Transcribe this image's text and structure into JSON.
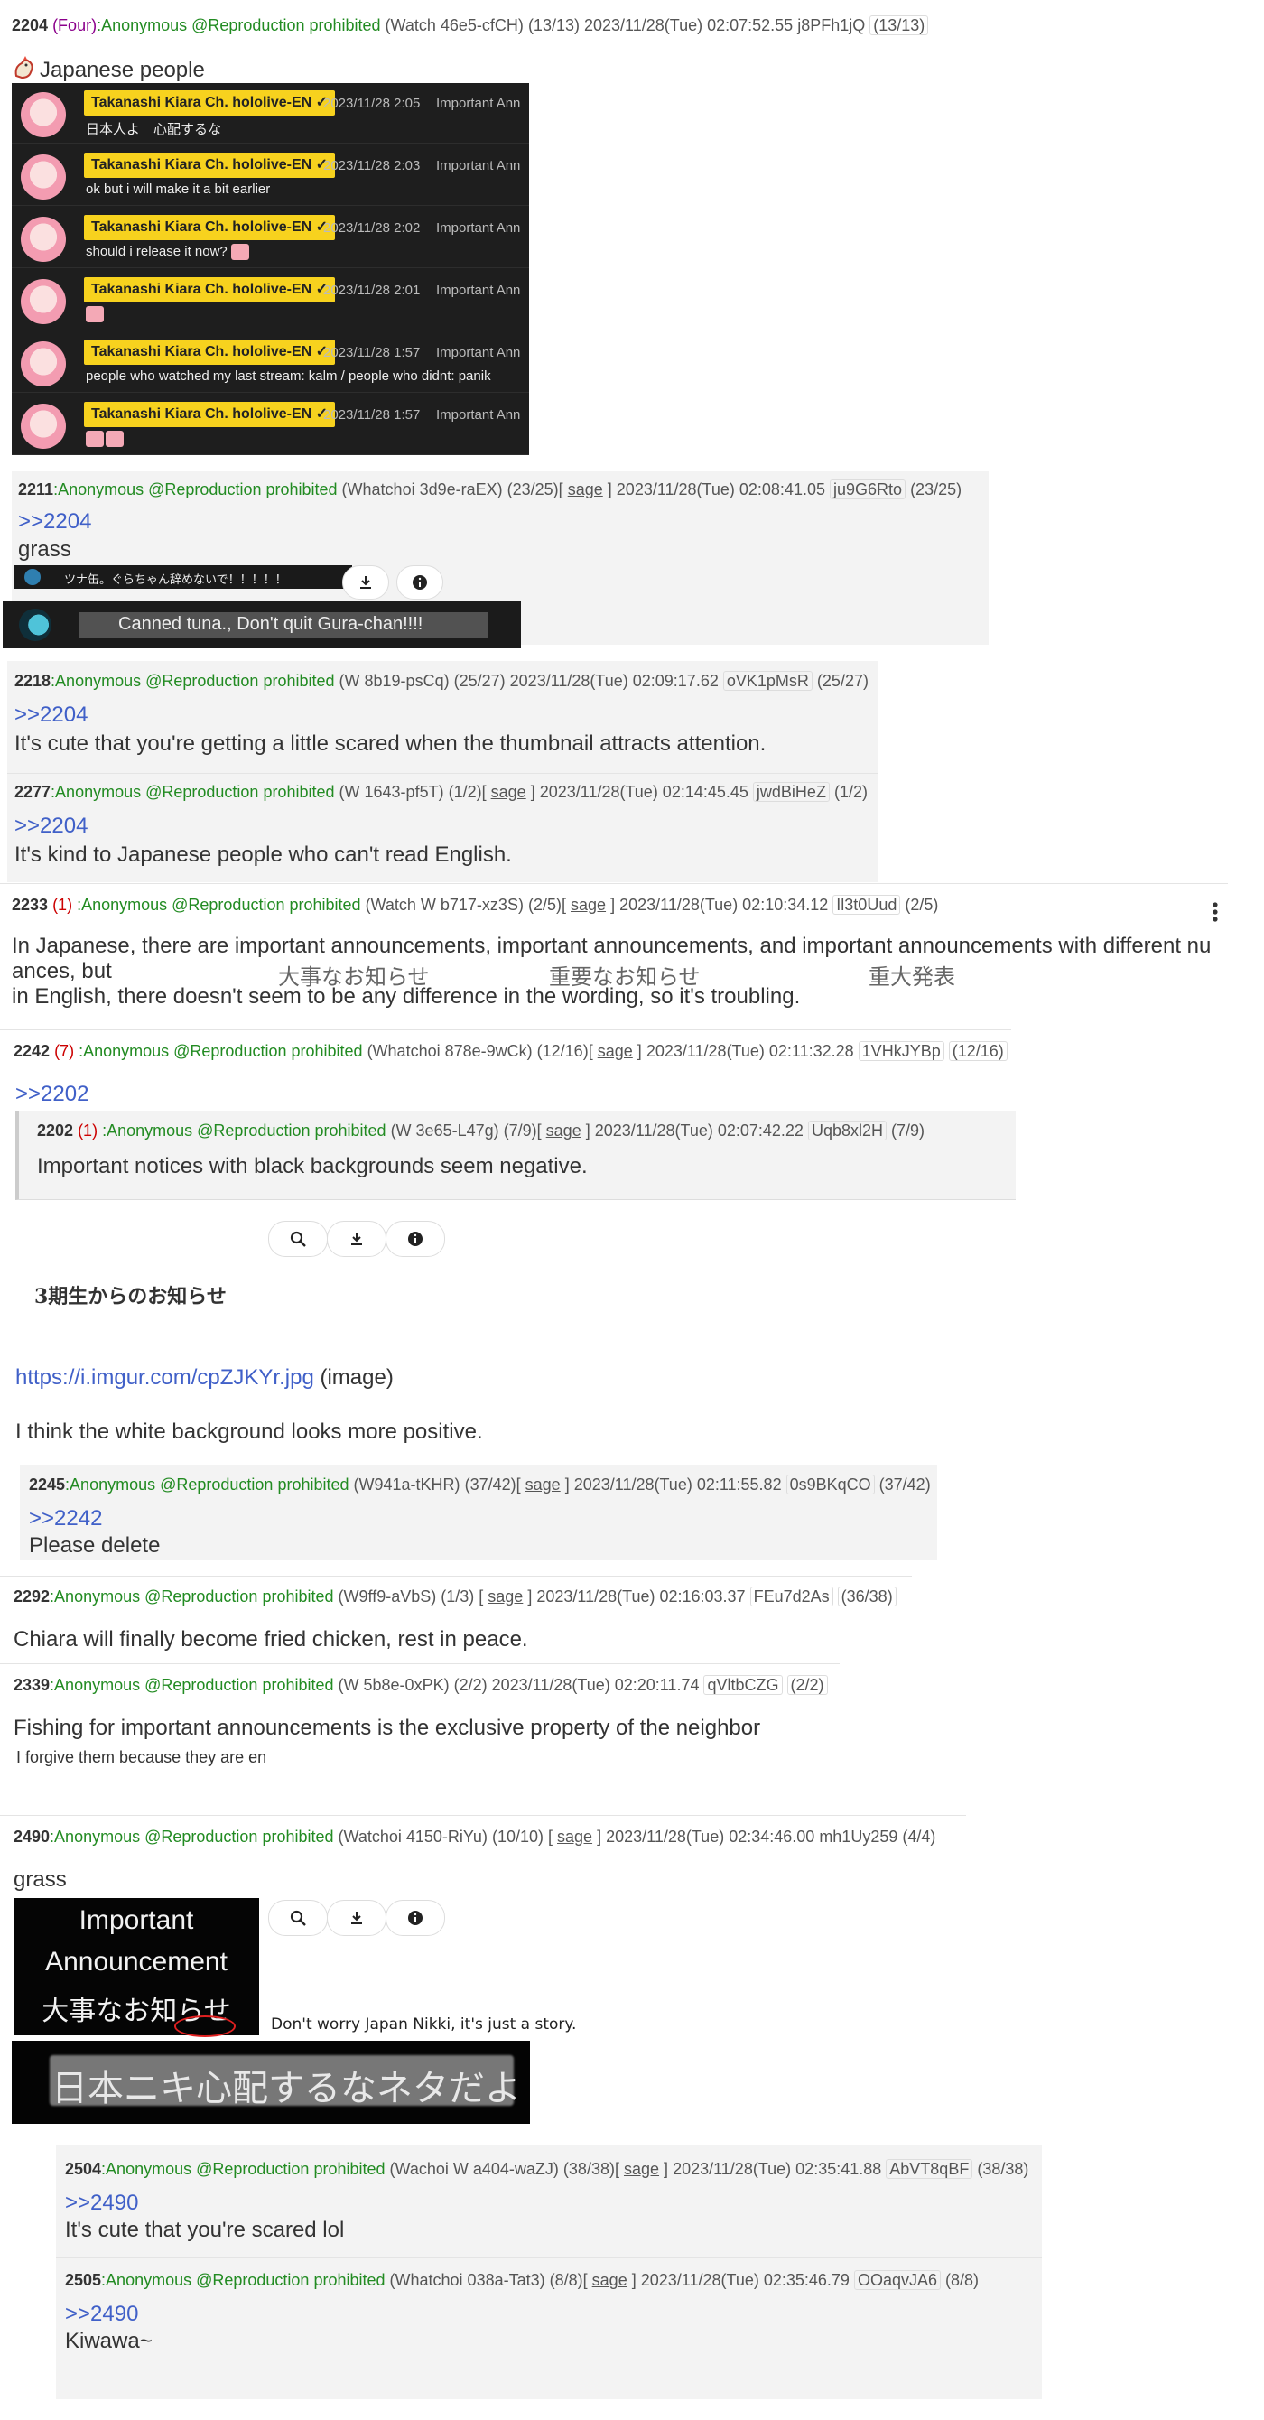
{
  "p2204": {
    "no": "2204",
    "four": "(Four)",
    "name": ":Anonymous @Reproduction prohibited",
    "id": "(Watch 46e5-cfCH)",
    "count": "(13/13)",
    "date": "2023/11/28(Tue) 02:07:52.55",
    "uid": "j8PFh1jQ",
    "count2": "(13/13)",
    "body": "Japanese people",
    "chat": [
      {
        "name": "Takanashi Kiara Ch. hololive-EN ✓",
        "time": "2023/11/28 2:05",
        "imp": "Important Ann",
        "msg": "日本人よ　心配するな"
      },
      {
        "name": "Takanashi Kiara Ch. hololive-EN ✓",
        "time": "2023/11/28 2:03",
        "imp": "Important Ann",
        "msg": "ok but i will make it a bit earlier"
      },
      {
        "name": "Takanashi Kiara Ch. hololive-EN ✓",
        "time": "2023/11/28 2:02",
        "imp": "Important Ann",
        "msg": "should i release it now?"
      },
      {
        "name": "Takanashi Kiara Ch. hololive-EN ✓",
        "time": "2023/11/28 2:01",
        "imp": "Important Ann",
        "msg": ""
      },
      {
        "name": "Takanashi Kiara Ch. hololive-EN ✓",
        "time": "2023/11/28 1:57",
        "imp": "Important Ann",
        "msg": "people who watched my last stream: kalm / people who didnt: panik"
      },
      {
        "name": "Takanashi Kiara Ch. hololive-EN ✓",
        "time": "2023/11/28 1:57",
        "imp": "Important Ann",
        "msg": ""
      }
    ]
  },
  "p2211": {
    "no": "2211",
    "name": ":Anonymous @Reproduction prohibited",
    "id": "(Whatchoi 3d9e-raEX)",
    "count": "(23/25)[",
    "sage": "sage",
    "close": "]",
    "date": "2023/11/28(Tue) 02:08:41.05",
    "uid": "ju9G6Rto",
    "count2": "(23/25)",
    "ref": ">>2204",
    "body": "grass",
    "video_title": "ツナ缶。ぐらちゃん辞めないで！！！！！",
    "caption": "Canned tuna., Don't quit Gura-chan!!!!"
  },
  "p2218": {
    "no": "2218",
    "name": ":Anonymous @Reproduction prohibited",
    "id": "(W 8b19-psCq)",
    "count": "(25/27)",
    "date": "2023/11/28(Tue) 02:09:17.62",
    "uid": "oVK1pMsR",
    "count2": "(25/27)",
    "ref": ">>2204",
    "body": "It's cute that you're getting a little scared when the thumbnail attracts attention."
  },
  "p2277": {
    "no": "2277",
    "name": ":Anonymous @Reproduction prohibited",
    "id": "(W 1643-pf5T)",
    "count": "(1/2)[",
    "sage": "sage",
    "close": "]",
    "date": "2023/11/28(Tue) 02:14:45.45",
    "uid": "jwdBiHeZ",
    "count2": "(1/2)",
    "ref": ">>2204",
    "body": "It's kind to Japanese people who can't read English."
  },
  "p2233": {
    "no": "2233",
    "cnt": "(1)",
    "name": ":Anonymous @Reproduction prohibited",
    "id": "(Watch W b717-xz3S)",
    "count": "(2/5)[",
    "sage": "sage",
    "close": "]",
    "date": "2023/11/28(Tue) 02:10:34.12",
    "uid": "Il3t0Uud",
    "count2": "(2/5)",
    "line1": "In Japanese, there are important announcements, important announcements, and important announcements with different nu",
    "line2a": "ances, but",
    "jp1": "大事なお知らせ",
    "jp2": "重要なお知らせ",
    "jp3": "重大発表",
    "line3": "in English, there doesn't seem to be any difference in the wording, so it's troubling."
  },
  "p2242": {
    "no": "2242",
    "cnt": "(7)",
    "name": ":Anonymous @Reproduction prohibited",
    "id": "(Whatchoi 878e-9wCk)",
    "count": "(12/16)[",
    "sage": "sage",
    "close": "]",
    "date": "2023/11/28(Tue) 02:11:32.28",
    "uid": "1VHkJYBp",
    "count2": "(12/16)",
    "ref": ">>2202",
    "quote": {
      "no": "2202",
      "cnt": "(1)",
      "name": ":Anonymous @Reproduction prohibited",
      "id": "(W 3e65-L47g)",
      "count": "(7/9)[",
      "sage": "sage",
      "close": "]",
      "date": "2023/11/28(Tue) 02:07:42.22",
      "uid": "Uqb8xl2H",
      "count2": "(7/9)",
      "body": "Important notices with black backgrounds seem negative."
    },
    "image_title": "3期生からのお知らせ",
    "link": "https://i.imgur.com/cpZJKYr.jpg",
    "link_suffix": "(image)",
    "body": "I think the white background looks more positive."
  },
  "p2245": {
    "no": "2245",
    "name": ":Anonymous @Reproduction prohibited",
    "id": "(W941a-tKHR)",
    "count": "(37/42)[",
    "sage": "sage",
    "close": "]",
    "date": "2023/11/28(Tue) 02:11:55.82",
    "uid": "0s9BKqCO",
    "count2": "(37/42)",
    "ref": ">>2242",
    "body": "Please delete"
  },
  "p2292": {
    "no": "2292",
    "name": ":Anonymous @Reproduction prohibited",
    "id": "(W9ff9-aVbS)",
    "count": "(1/3) [",
    "sage": "sage",
    "close": "]",
    "date": "2023/11/28(Tue) 02:16:03.37",
    "uid": "FEu7d2As",
    "count2": "(36/38)",
    "body": "Chiara will finally become fried chicken, rest in peace."
  },
  "p2339": {
    "no": "2339",
    "name": ":Anonymous @Reproduction prohibited",
    "id": "(W 5b8e-0xPK)",
    "count": "(2/2)",
    "date": "2023/11/28(Tue) 02:20:11.74",
    "uid": "qVltbCZG",
    "count2": "(2/2)",
    "body": "Fishing for important announcements is the exclusive property of the neighbor",
    "small": "I forgive them because they are en"
  },
  "p2490": {
    "no": "2490",
    "name": ":Anonymous @Reproduction prohibited",
    "id": "(Watchoi 4150-RiYu)",
    "count": "(10/10) [",
    "sage": "sage",
    "close": "]",
    "date": "2023/11/28(Tue) 02:34:46.00",
    "uid": "mh1Uy259",
    "count2": "(4/4)",
    "body": "grass",
    "img_line1": "Important",
    "img_line2": "Announcement",
    "img_line3": "大事なお知らせ",
    "caption": "Don't worry Japan Nikki, it's just a story.",
    "banner": "日本ニキ心配するなネタだよ"
  },
  "p2504": {
    "no": "2504",
    "name": ":Anonymous @Reproduction prohibited",
    "id": "(Wachoi W a404-waZJ)",
    "count": "(38/38)[",
    "sage": "sage",
    "close": "]",
    "date": "2023/11/28(Tue) 02:35:41.88",
    "uid": "AbVT8qBF",
    "count2": "(38/38)",
    "ref": ">>2490",
    "body": "It's cute that you're scared lol"
  },
  "p2505": {
    "no": "2505",
    "name": ":Anonymous @Reproduction prohibited",
    "id": "(Whatchoi 038a-Tat3)",
    "count": "(8/8)[",
    "sage": "sage",
    "close": "]",
    "date": "2023/11/28(Tue) 02:35:46.79",
    "uid": "OOaqvJA6",
    "count2": "(8/8)",
    "ref": ">>2490",
    "body": "Kiwawa~"
  },
  "icons": {
    "search": "search-icon",
    "download": "download-icon",
    "info": "info-icon",
    "more": "more-vertical-icon"
  },
  "colors": {
    "name_green": "#228b22",
    "ref_blue": "#4060c8",
    "badge_yellow": "#f7d21e"
  }
}
